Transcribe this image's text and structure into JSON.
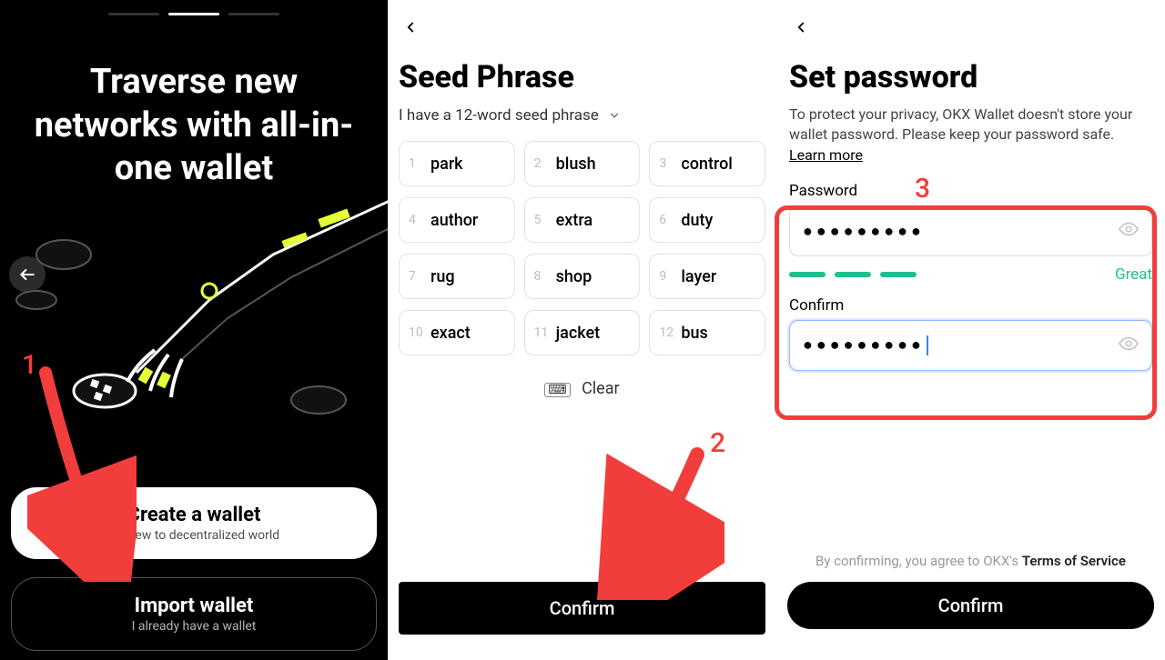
{
  "panel1": {
    "title": "Traverse new networks with all-in-one wallet",
    "create": {
      "title": "Create a wallet",
      "sub": "I'm new to decentralized world"
    },
    "import": {
      "title": "Import wallet",
      "sub": "I already have a wallet"
    }
  },
  "panel2": {
    "title": "Seed Phrase",
    "dropdown": "I have a 12-word seed phrase",
    "words": [
      "park",
      "blush",
      "control",
      "author",
      "extra",
      "duty",
      "rug",
      "shop",
      "layer",
      "exact",
      "jacket",
      "bus"
    ],
    "clear": "Clear",
    "confirm": "Confirm"
  },
  "panel3": {
    "title": "Set password",
    "desc_prefix": "To protect your privacy, OKX Wallet doesn't store your wallet password. Please keep your password safe.  ",
    "learn_more": "Learn more",
    "pw_label": "Password",
    "pw_mask": "●●●●●●●●●",
    "strength": "Great",
    "confirm_label": "Confirm",
    "confirm_mask": "●●●●●●●●●",
    "tos_prefix": "By confirming, you agree to OKX's ",
    "tos_link": "Terms of Service",
    "confirm_btn": "Confirm"
  },
  "anno": {
    "n1": "1",
    "n2": "2",
    "n3": "3"
  }
}
